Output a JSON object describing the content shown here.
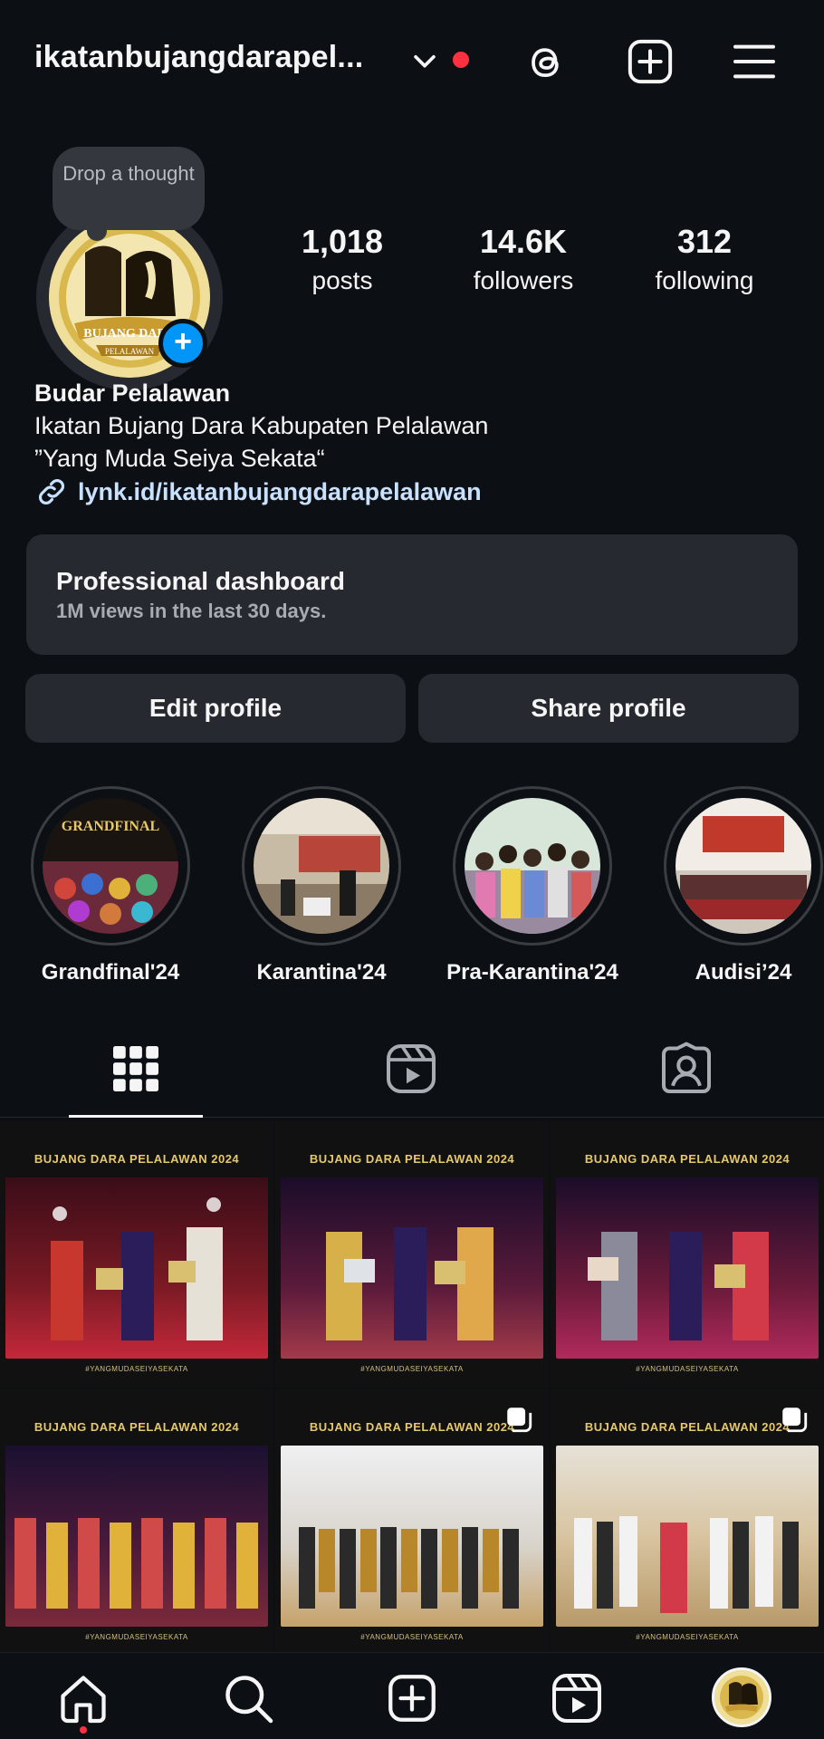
{
  "header": {
    "username": "ikatanbujangdarapel...",
    "dropdown_icon": "chevron-down-icon",
    "notification_dot_color": "#ff3040",
    "icons": [
      "threads-icon",
      "new-post-icon",
      "menu-icon"
    ]
  },
  "profile": {
    "thought_bubble": "Drop a thought",
    "stats": [
      {
        "value": "1,018",
        "label": "posts"
      },
      {
        "value": "14.6K",
        "label": "followers"
      },
      {
        "value": "312",
        "label": "following"
      }
    ],
    "name": "Budar Pelalawan",
    "bio_line1": "Ikatan Bujang Dara Kabupaten Pelalawan",
    "bio_line2": "”Yang Muda Seiya Sekata“",
    "link": "lynk.id/ikatanbujangdarapelalawan",
    "avatar_text": "BUJANG DARA",
    "avatar_subtext": "PELALAWAN"
  },
  "dashboard": {
    "title": "Professional dashboard",
    "subtitle": "1M views in the last 30 days."
  },
  "buttons": {
    "edit": "Edit profile",
    "share": "Share profile"
  },
  "highlights": [
    {
      "label": "Grandfinal'24",
      "cover_title": "GRANDFINAL"
    },
    {
      "label": "Karantina'24"
    },
    {
      "label": "Pra-Karantina'24"
    },
    {
      "label": "Audisi’24"
    }
  ],
  "tabs": [
    "grid-icon",
    "reels-icon",
    "tagged-icon"
  ],
  "posts": {
    "banner": "BUJANG DARA PELALAWAN 2024",
    "tagline": "#YANGMUDASEIYASEKATA"
  },
  "bottom_nav": [
    "home-icon",
    "search-icon",
    "create-icon",
    "reels-icon",
    "profile-avatar"
  ],
  "colors": {
    "background": "#0c1014",
    "surface": "#262a30",
    "accent_blue": "#0095f6",
    "gold": "#e6c86a"
  }
}
